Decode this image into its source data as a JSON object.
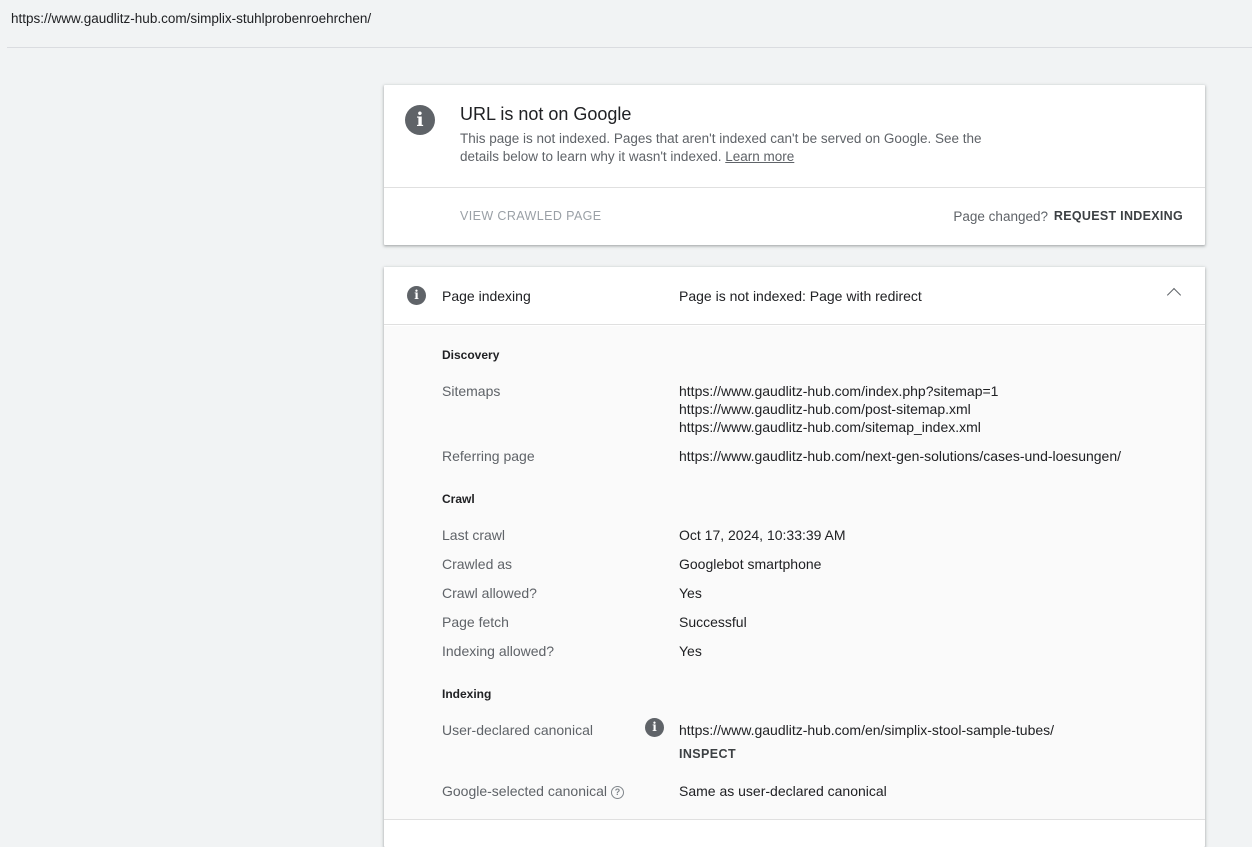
{
  "url_bar": {
    "url": "https://www.gaudlitz-hub.com/simplix-stuhlprobenroehrchen/"
  },
  "status_card": {
    "title": "URL is not on Google",
    "description": "This page is not indexed. Pages that aren't indexed can't be served on Google. See the details below to learn why it wasn't indexed.",
    "learn_more": "Learn more",
    "view_crawled": "VIEW CRAWLED PAGE",
    "page_changed": "Page changed?",
    "request_indexing": "REQUEST INDEXING"
  },
  "indexing_card": {
    "label": "Page indexing",
    "status": "Page is not indexed: Page with redirect",
    "discovery": {
      "heading": "Discovery",
      "sitemaps_label": "Sitemaps",
      "sitemaps": [
        "https://www.gaudlitz-hub.com/index.php?sitemap=1",
        "https://www.gaudlitz-hub.com/post-sitemap.xml",
        "https://www.gaudlitz-hub.com/sitemap_index.xml"
      ],
      "referring_label": "Referring page",
      "referring_value": "https://www.gaudlitz-hub.com/next-gen-solutions/cases-und-loesungen/"
    },
    "crawl": {
      "heading": "Crawl",
      "rows": [
        {
          "label": "Last crawl",
          "value": "Oct 17, 2024, 10:33:39 AM"
        },
        {
          "label": "Crawled as",
          "value": "Googlebot smartphone"
        },
        {
          "label": "Crawl allowed?",
          "value": "Yes"
        },
        {
          "label": "Page fetch",
          "value": "Successful"
        },
        {
          "label": "Indexing allowed?",
          "value": "Yes"
        }
      ]
    },
    "indexing": {
      "heading": "Indexing",
      "user_canonical_label": "User-declared canonical",
      "user_canonical_value": "https://www.gaudlitz-hub.com/en/simplix-stool-sample-tubes/",
      "inspect": "INSPECT",
      "google_canonical_label": "Google-selected canonical",
      "google_canonical_value": "Same as user-declared canonical"
    }
  },
  "icons": {
    "info": "info-icon",
    "help": "help-icon",
    "chevron": "chevron-up-icon"
  },
  "colors": {
    "background": "#f1f3f4",
    "icon": "#5f6368",
    "text": "#202124",
    "secondary": "#5f6368"
  }
}
